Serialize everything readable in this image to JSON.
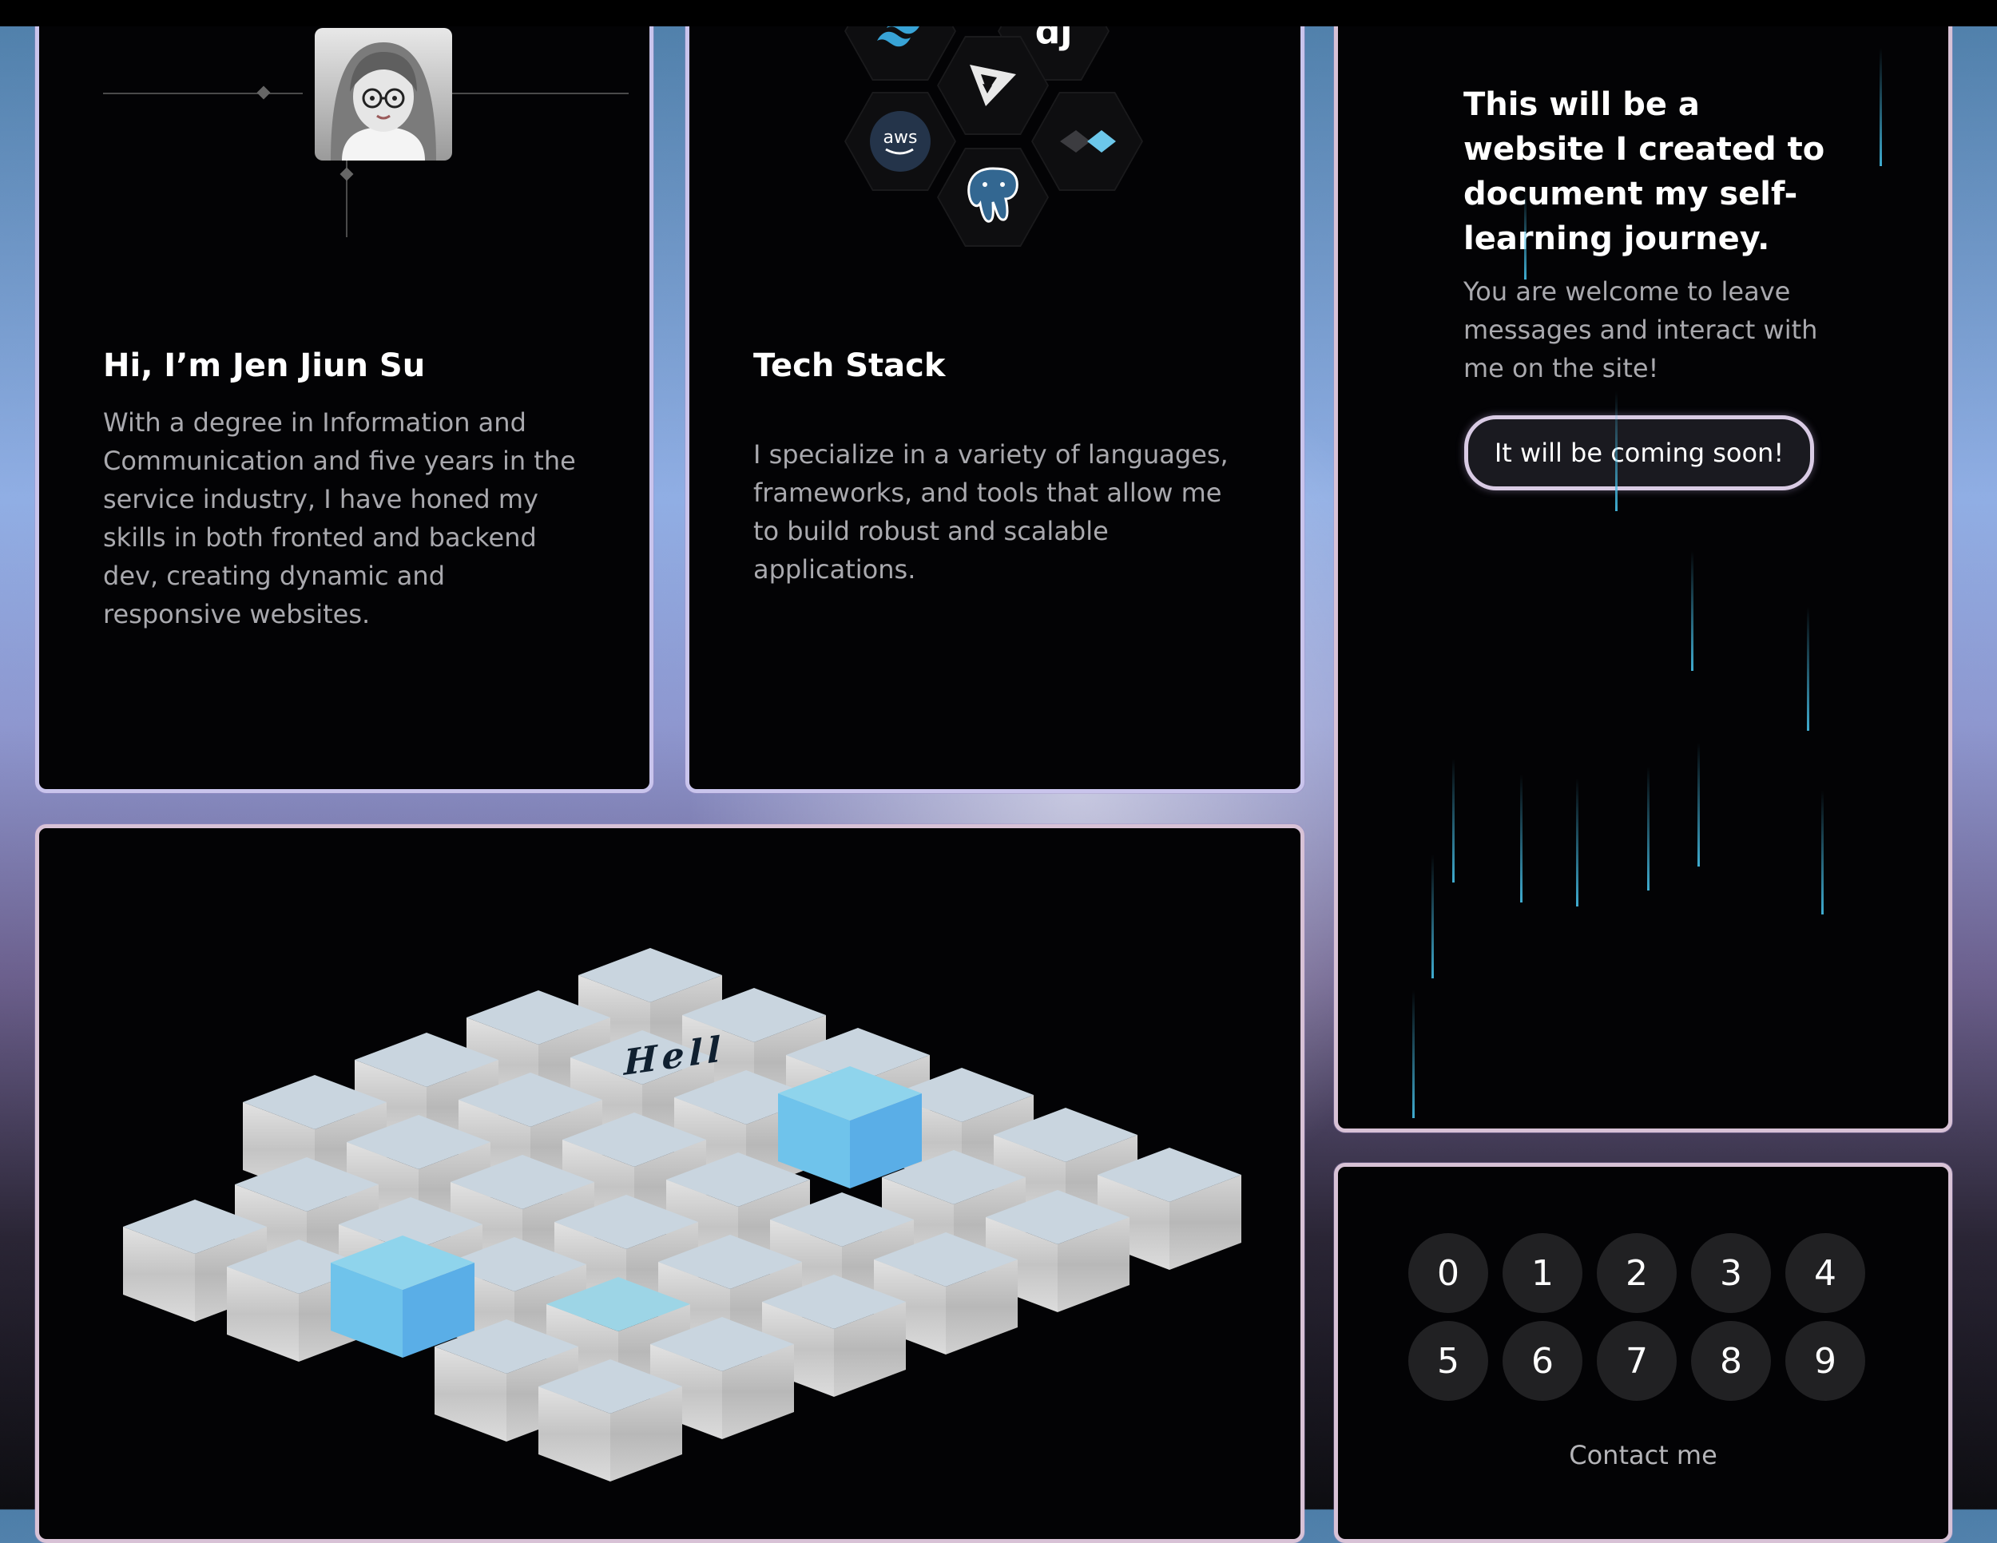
{
  "intro": {
    "title": "Hi, I’m Jen Jiun Su",
    "description": "With a degree in Information and Communication and five years in the service industry, I have honed my skills in both fronted and backend dev, creating dynamic and responsive websites."
  },
  "tech": {
    "title": "Tech Stack",
    "description": "I specialize in a variety of languages, frameworks, and tools that allow me to build robust and scalable applications.",
    "icons": [
      "tailwind-icon",
      "django-icon",
      "vite-icon",
      "aws-icon",
      "postgresql-icon",
      "chevron-logo-icon"
    ],
    "aws_text": "aws",
    "dj_text": "dj"
  },
  "journey": {
    "title": "This will be a website I created to document my self-learning journey.",
    "description": "You are welcome to leave messages and interact with me on the site!",
    "button": "It will be coming soon!"
  },
  "cubes": {
    "label": "Hell"
  },
  "contact": {
    "digits": [
      "0",
      "1",
      "2",
      "3",
      "4",
      "5",
      "6",
      "7",
      "8",
      "9"
    ],
    "label": "Contact me"
  },
  "colors": {
    "card_bg": "#030305",
    "cube_white": "#d3d8dd",
    "cube_blue": "#63b3ea",
    "rain": "#46bee6"
  }
}
